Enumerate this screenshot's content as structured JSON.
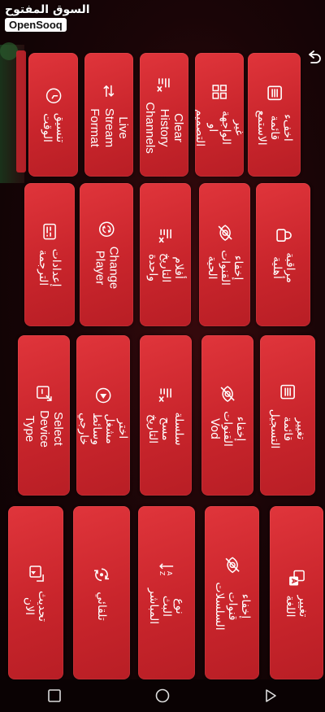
{
  "watermark": {
    "arabic": "السوق المفتوح",
    "english": "OpenSooq"
  },
  "tiles": {
    "vod_list": "اخفء قائمة الاستمع",
    "interface_change": "غير الواجهة او التصميم",
    "clear_history": "Clear History Channels",
    "live_stream_format": "Live Stream Format",
    "time_format": "تنسيق الوقت",
    "parental_control": "مراقبة أهلية",
    "hide_live_channels": "إخفاء القنوات الحية",
    "catchup_single": "أفلام التاريخ واحدة",
    "change_player": "Change Player",
    "translation_settings": "إعدادات الترجمة",
    "record_list": "تغيير قائمة التسجيل",
    "hide_vod_channels": "إخفاء القنوات Vod",
    "clear_history_series": "سلسلة مسح التاريخ",
    "external_player": "اختر مشغل وسائط خارجي",
    "select_device_type": "Select Device Type",
    "change_language": "تغيير اللغة",
    "hide_series": "إخفاء قنوات السلسلات",
    "live_stream_type": "نوع البث المباشر",
    "auto_start": "تلقائي",
    "update_now": "تحديث الان"
  },
  "icons": {
    "vod_list": "list-icon",
    "interface_change": "grid-icon",
    "clear_history": "clear-list-icon",
    "live_stream_format": "stream-arrows-icon",
    "time_format": "clock-icon",
    "parental_control": "lock-icon",
    "hide_live_channels": "eye-off-icon",
    "catchup_single": "clear-list-icon",
    "change_player": "refresh-icon",
    "translation_settings": "subtitles-icon",
    "record_list": "list-icon",
    "hide_vod_channels": "eye-off-icon",
    "clear_history_series": "clear-list-icon",
    "external_player": "play-circle-icon",
    "select_device_type": "device-icon",
    "change_language": "translate-icon",
    "hide_series": "eye-off-icon",
    "live_stream_type": "sort-az-icon",
    "auto_start": "sync-icon",
    "update_now": "update-icon"
  },
  "colors": {
    "tile": "#c9252c",
    "background": "#1a0507"
  }
}
